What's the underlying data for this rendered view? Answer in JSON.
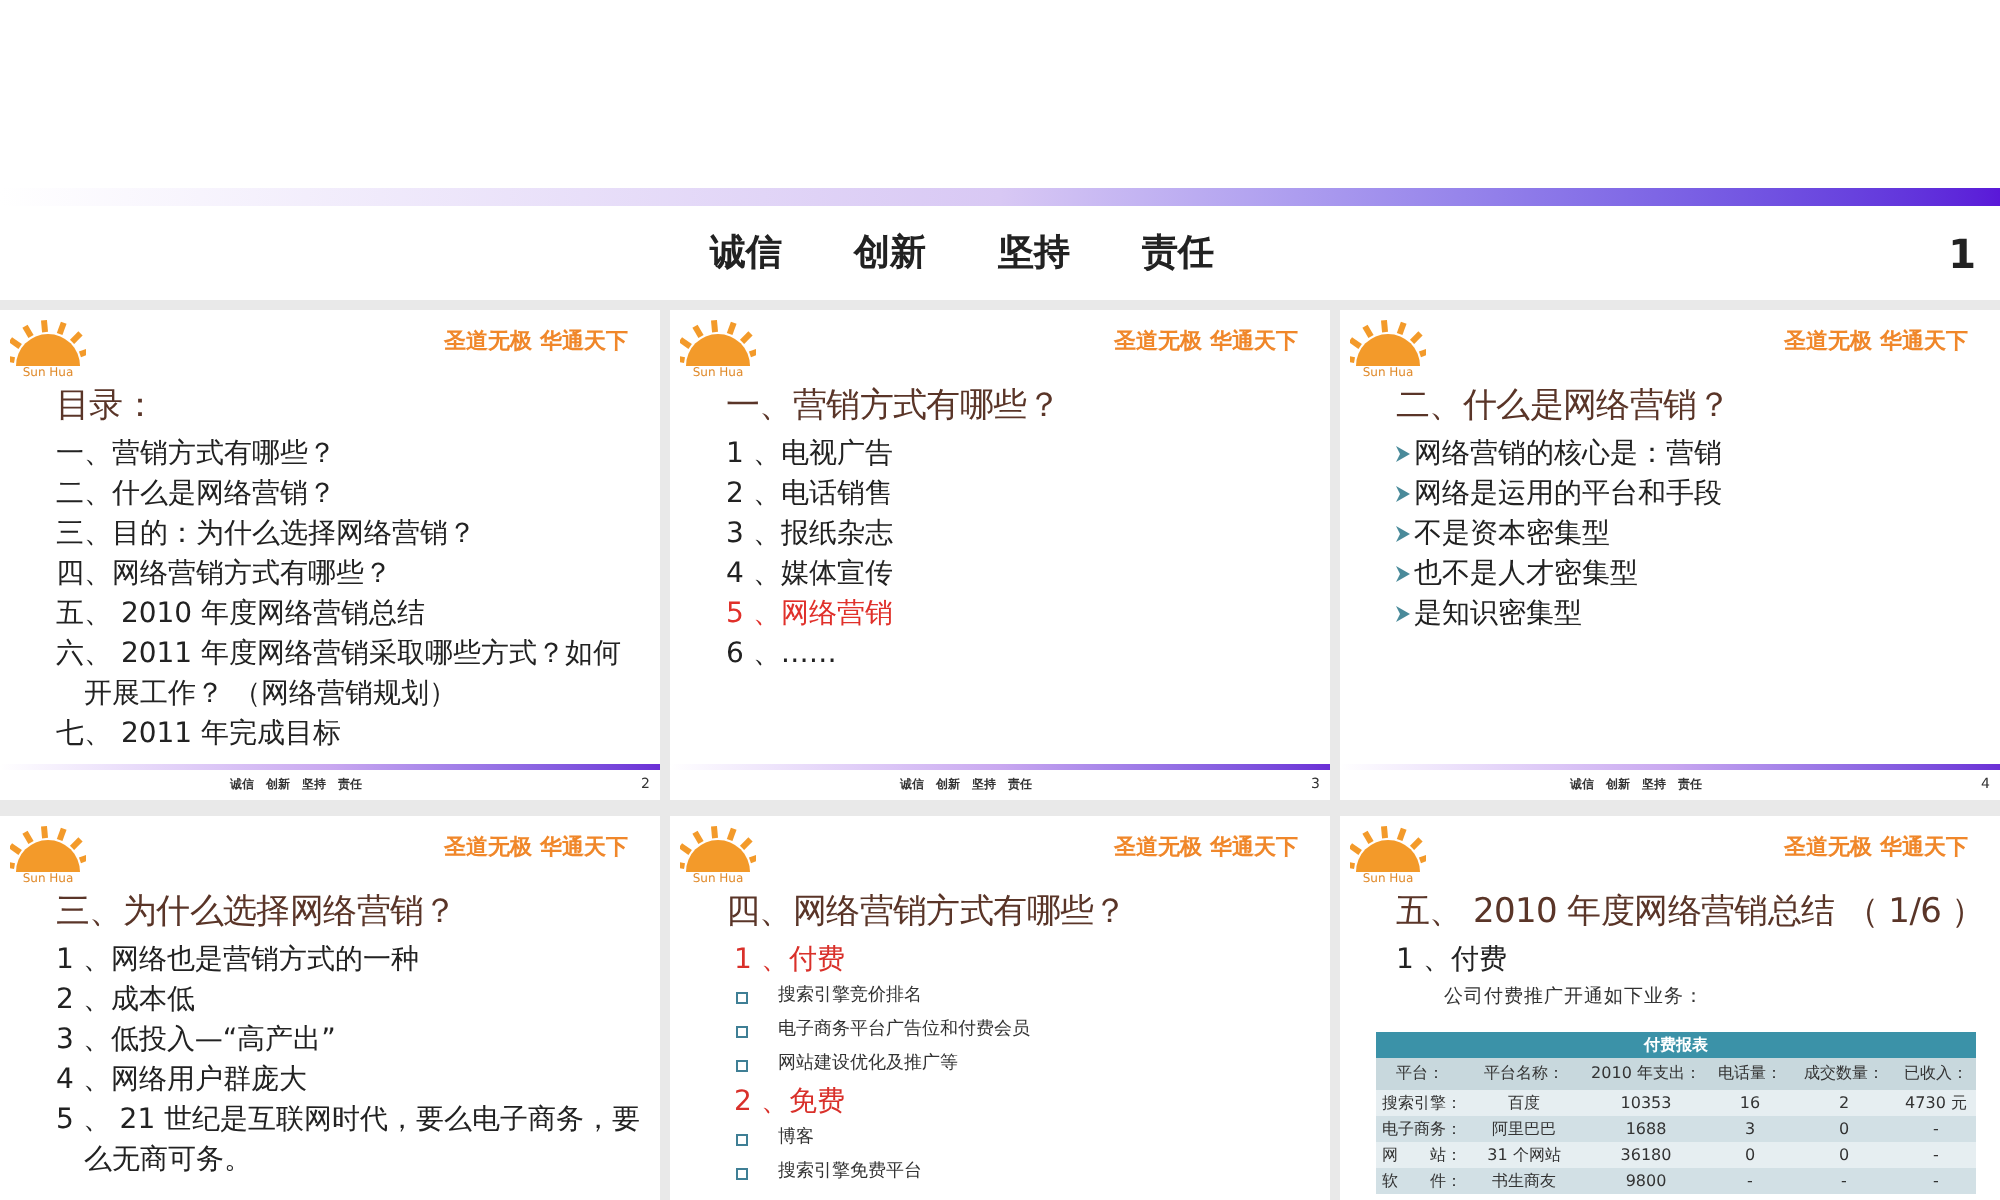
{
  "header": {
    "motto": "诚信　　创新　　坚持　　责任",
    "page": "1"
  },
  "slides": [
    {
      "logo_caption": "Sun Hua",
      "slogan": "圣道无极 华通天下",
      "title": "目录：",
      "items": [
        {
          "kind": "line",
          "text": "一、营销方式有哪些？"
        },
        {
          "kind": "line",
          "text": "二、什么是网络营销？"
        },
        {
          "kind": "line",
          "text": "三、目的：为什么选择网络营销？"
        },
        {
          "kind": "line",
          "text": "四、网络营销方式有哪些？"
        },
        {
          "kind": "line",
          "text": "五、 2010 年度网络营销总结"
        },
        {
          "kind": "line",
          "text": "六、 2011 年度网络营销采取哪些方式？如何开展工作？ （网络营销规划）"
        },
        {
          "kind": "line",
          "text": "七、 2011 年完成目标"
        }
      ],
      "footer": {
        "motto": "诚信　创新　坚持　责任",
        "page": "2"
      }
    },
    {
      "logo_caption": "Sun Hua",
      "slogan": "圣道无极 华通天下",
      "title": "一、营销方式有哪些？",
      "items": [
        {
          "kind": "line",
          "text": "1 、电视广告",
          "highlight": false
        },
        {
          "kind": "line",
          "text": "2 、电话销售",
          "highlight": false
        },
        {
          "kind": "line",
          "text": "3 、报纸杂志",
          "highlight": false
        },
        {
          "kind": "line",
          "text": "4 、媒体宣传",
          "highlight": false
        },
        {
          "kind": "line",
          "text": "5 、网络营销",
          "highlight": true
        },
        {
          "kind": "line",
          "text": "6 、……",
          "highlight": false
        }
      ],
      "footer": {
        "motto": "诚信　创新　坚持　责任",
        "page": "3"
      }
    },
    {
      "logo_caption": "Sun Hua",
      "slogan": "圣道无极 华通天下",
      "title": "二、什么是网络营销？",
      "items": [
        {
          "kind": "arrow",
          "text": "网络营销的核心是：营销"
        },
        {
          "kind": "arrow",
          "text": "网络是运用的平台和手段"
        },
        {
          "kind": "arrow",
          "text": "不是资本密集型"
        },
        {
          "kind": "arrow",
          "text": "也不是人才密集型"
        },
        {
          "kind": "arrow",
          "text": "是知识密集型"
        }
      ],
      "footer": {
        "motto": "诚信　创新　坚持　责任",
        "page": "4"
      }
    },
    {
      "logo_caption": "Sun Hua",
      "slogan": "圣道无极 华通天下",
      "title": "三、为什么选择网络营销？",
      "items": [
        {
          "kind": "line",
          "text": "1 、网络也是营销方式的一种"
        },
        {
          "kind": "line",
          "text": "2 、成本低"
        },
        {
          "kind": "line",
          "text": "3 、低投入—“高产出”"
        },
        {
          "kind": "line",
          "text": "4 、网络用户群庞大"
        },
        {
          "kind": "line",
          "text": "5 、 21 世纪是互联网时代，要么电子商务，要么无商可务。"
        }
      ]
    },
    {
      "logo_caption": "Sun Hua",
      "slogan": "圣道无极 华通天下",
      "title": "四、网络营销方式有哪些？",
      "items": [
        {
          "kind": "subheading",
          "text": "1 、付费"
        },
        {
          "kind": "square",
          "text": "搜索引擎竞价排名"
        },
        {
          "kind": "square",
          "text": "电子商务平台广告位和付费会员"
        },
        {
          "kind": "square",
          "text": "网站建设优化及推广等"
        },
        {
          "kind": "subheading",
          "text": "2 、免费"
        },
        {
          "kind": "square",
          "text": "博客"
        },
        {
          "kind": "square",
          "text": "搜索引擎免费平台"
        }
      ]
    },
    {
      "logo_caption": "Sun Hua",
      "slogan": "圣道无极 华通天下",
      "title": "五、 2010 年度网络营销总结 （ 1/6 ）",
      "items": [
        {
          "kind": "line",
          "text": "1 、付费"
        },
        {
          "kind": "note",
          "text": "公司付费推广开通如下业务："
        },
        {
          "kind": "table",
          "title": "付费报表",
          "columns": [
            "平台：",
            "平台名称：",
            "2010 年支出：",
            "电话量：",
            "成交数量：",
            "已收入："
          ],
          "rows": [
            [
              "搜索引擎：",
              "百度",
              "10353",
              "16",
              "2",
              "4730 元"
            ],
            [
              "电子商务：",
              "阿里巴巴",
              "1688",
              "3",
              "0",
              "-"
            ],
            [
              "网　　站：",
              "31 个网站",
              "36180",
              "0",
              "0",
              "-"
            ],
            [
              "软　　件：",
              "书生商友",
              "9800",
              "-",
              "-",
              "-"
            ]
          ]
        }
      ]
    }
  ]
}
